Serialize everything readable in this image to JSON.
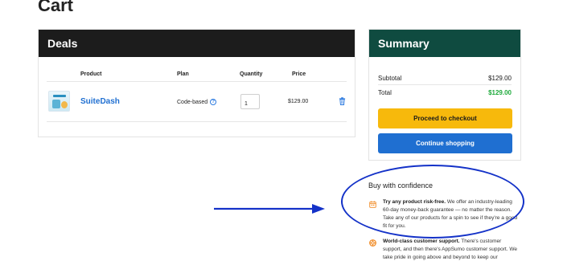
{
  "page": {
    "title": "Cart"
  },
  "deals": {
    "title": "Deals",
    "columns": {
      "product": "Product",
      "plan": "Plan",
      "quantity": "Quantity",
      "price": "Price"
    },
    "items": [
      {
        "product": "SuiteDash",
        "plan": "Code-based",
        "quantity": "1",
        "price": "$129.00"
      }
    ]
  },
  "summary": {
    "title": "Summary",
    "subtotal_label": "Subtotal",
    "subtotal_value": "$129.00",
    "total_label": "Total",
    "total_value": "$129.00",
    "checkout_label": "Proceed to checkout",
    "continue_label": "Continue shopping"
  },
  "confidence": {
    "title": "Buy with confidence",
    "items": [
      {
        "icon": "calendar-icon",
        "bold": "Try any product risk-free.",
        "text": " We offer an industry-leading 60-day money-back guarantee — no matter the reason. Take any of our products for a spin to see if they're a good fit for you."
      },
      {
        "icon": "lifebuoy-icon",
        "bold": "World-class customer support.",
        "text": " There's customer support, and then there's AppSumo customer support. We take pride in going above and beyond to keep our community"
      }
    ]
  },
  "colors": {
    "deals_header": "#1c1c1c",
    "summary_header": "#0f4b40",
    "link": "#1f6fd1",
    "total": "#1faa3c",
    "checkout": "#f7b90c",
    "continue": "#1f6fd1",
    "annotation": "#1432c8",
    "icon_orange": "#f08a24"
  }
}
